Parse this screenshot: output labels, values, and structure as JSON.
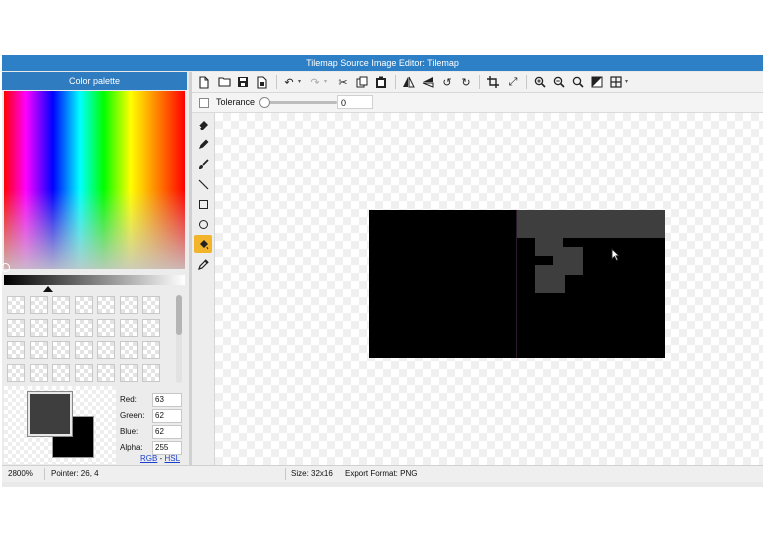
{
  "window": {
    "title": "Tilemap Source Image Editor: Tilemap"
  },
  "palette": {
    "title": "Color palette",
    "fields": [
      {
        "label": "Red:",
        "value": "63"
      },
      {
        "label": "Green:",
        "value": "62"
      },
      {
        "label": "Blue:",
        "value": "62"
      },
      {
        "label": "Alpha:",
        "value": "255"
      }
    ],
    "primary_color": "#3f3e3e",
    "secondary_color": "#000000",
    "link_rgb": "RGB",
    "link_sep": "-",
    "link_hsl": "HSL"
  },
  "toolbar": {
    "icons": [
      "new-file-icon",
      "open-folder-icon",
      "save-icon",
      "save-as-icon",
      "undo-icon",
      "redo-icon",
      "cut-icon",
      "copy-icon",
      "paste-icon",
      "flip-horizontal-icon",
      "flip-vertical-icon",
      "rotate-left-icon",
      "rotate-right-icon",
      "crop-icon",
      "resize-icon",
      "zoom-in-icon",
      "zoom-out-icon",
      "zoom-reset-icon",
      "toggle-transparency-icon",
      "grid-icon"
    ]
  },
  "tolerance": {
    "label": "Tolerance",
    "value": "0",
    "level": 0
  },
  "tools": {
    "icons": [
      "eraser-icon",
      "pencil-icon",
      "brush-icon",
      "line-icon",
      "rectangle-icon",
      "ellipse-icon",
      "fill-bucket-icon",
      "eyedropper-icon"
    ],
    "active": "fill-bucket-icon"
  },
  "status": {
    "zoom": "2800%",
    "pointer": "Pointer: 26, 4",
    "size": "Size: 32x16",
    "format": "Export Format: PNG"
  }
}
